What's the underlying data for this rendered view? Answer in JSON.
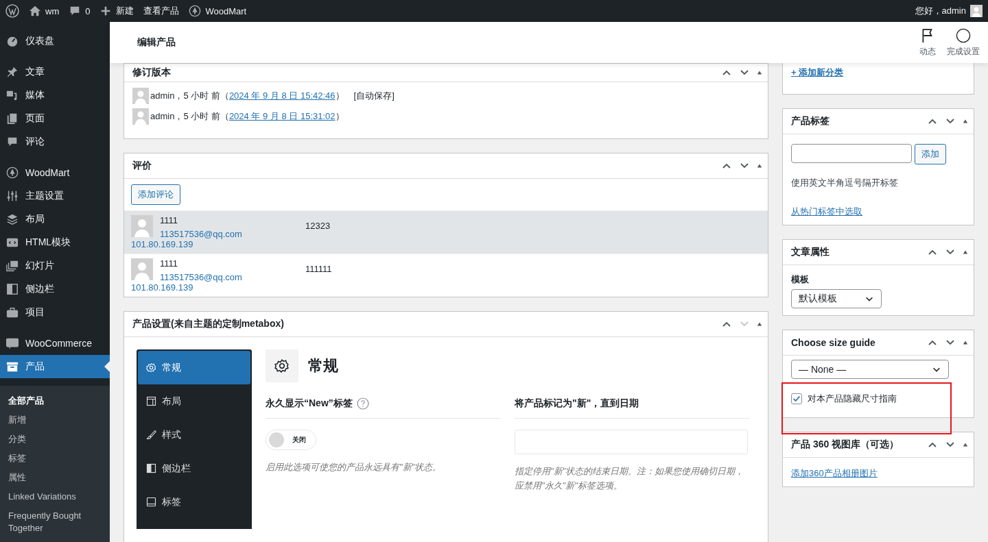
{
  "admin_bar": {
    "items": [
      {
        "kind": "wp-logo"
      },
      {
        "kind": "home",
        "label": "wm"
      },
      {
        "kind": "comment",
        "label": "0"
      },
      {
        "kind": "plus",
        "label": "新建"
      },
      {
        "kind": "text",
        "label": "查看产品"
      },
      {
        "kind": "tree",
        "label": "WoodMart"
      }
    ],
    "greeting": "您好，admin"
  },
  "sidebar": {
    "groups": [
      [
        {
          "kind": "dashboard",
          "label": "仪表盘",
          "selected": false
        }
      ],
      [
        {
          "kind": "pin",
          "label": "文章",
          "selected": false
        },
        {
          "kind": "media",
          "label": "媒体",
          "selected": false
        },
        {
          "kind": "page",
          "label": "页面",
          "selected": false
        },
        {
          "kind": "comment",
          "label": "评论",
          "selected": false
        }
      ],
      [
        {
          "kind": "tree",
          "label": "WoodMart",
          "selected": false
        },
        {
          "kind": "sliders",
          "label": "主题设置",
          "selected": false
        },
        {
          "kind": "layers",
          "label": "布局",
          "selected": false
        },
        {
          "kind": "code",
          "label": "HTML模块",
          "selected": false
        },
        {
          "kind": "slides",
          "label": "幻灯片",
          "selected": false
        },
        {
          "kind": "sidebar",
          "label": "侧边栏",
          "selected": false
        },
        {
          "kind": "briefcase",
          "label": "项目",
          "selected": false
        }
      ],
      [
        {
          "kind": "woo",
          "label": "WooCommerce",
          "selected": false
        },
        {
          "kind": "box",
          "label": "产品",
          "selected": true
        }
      ]
    ],
    "submenu": [
      {
        "label": "全部产品",
        "selected": true
      },
      {
        "label": "新增",
        "selected": false
      },
      {
        "label": "分类",
        "selected": false
      },
      {
        "label": "标签",
        "selected": false
      },
      {
        "label": "属性",
        "selected": false
      },
      {
        "label": "Linked Variations",
        "selected": false
      },
      {
        "label": "Frequently Bought Together",
        "selected": false
      }
    ]
  },
  "header": {
    "title": "编辑产品",
    "actions": [
      {
        "kind": "flag",
        "label": "动态"
      },
      {
        "kind": "circle",
        "label": "完成设置"
      }
    ]
  },
  "revisions": {
    "title": "修订版本",
    "items": [
      {
        "text": "admin，5 小时 前（",
        "date": "2024 年 9 月 8 日 15:42:46",
        "after": "）",
        "note": "[自动保存]"
      },
      {
        "text": "admin，5 小时 前（",
        "date": "2024 年 9 月 8 日 15:31:02",
        "after": "）"
      }
    ]
  },
  "reviews": {
    "title": "评价",
    "add_button": "添加评论",
    "rows": [
      {
        "author": "1111",
        "email": "113517536@qq.com",
        "ip": "101.80.169.139",
        "content": "12323",
        "highlighted": true
      },
      {
        "author": "1111",
        "email": "113517536@qq.com",
        "ip": "101.80.169.139",
        "content": "111111",
        "highlighted": false
      }
    ]
  },
  "product_settings": {
    "title": "产品设置(来自主题的定制metabox)",
    "tabs": [
      {
        "kind": "gear",
        "label": "常规",
        "selected": true
      },
      {
        "kind": "layout",
        "label": "布局",
        "selected": false
      },
      {
        "kind": "brush",
        "label": "样式",
        "selected": false
      },
      {
        "kind": "sidebar",
        "label": "侧边栏",
        "selected": false
      },
      {
        "kind": "tag",
        "label": "标签",
        "selected": false
      }
    ],
    "section_title": "常规",
    "fields": [
      {
        "kind": "toggle",
        "label": "永久显示“New”标签",
        "help": true,
        "on": false,
        "toggle_label": "关闭",
        "description": "启用此选项可使您的产品永远具有\"新\"状态。"
      },
      {
        "kind": "date",
        "label": "将产品标记为\"新\"，直到日期",
        "help": false,
        "description": "指定停用\"新\"状态的结束日期。注：如果您使用确切日期，应禁用\"永久\"新\"标签选项。"
      }
    ]
  },
  "categories": {
    "add_link": "+ 添加新分类"
  },
  "tags": {
    "title": "产品标签",
    "button": "添加",
    "hint": "使用英文半角逗号隔开标签",
    "link": "从热门标签中选取"
  },
  "attributes": {
    "title": "文章属性",
    "template_label": "模板",
    "template_value": "默认模板"
  },
  "size_guide": {
    "title": "Choose size guide",
    "select": "— None —",
    "checkbox": {
      "label": "对本产品隐藏尺寸指南",
      "checked": true
    }
  },
  "gallery": {
    "title": "产品 360 视图库（可选）",
    "link": "添加360产品相册图片"
  }
}
